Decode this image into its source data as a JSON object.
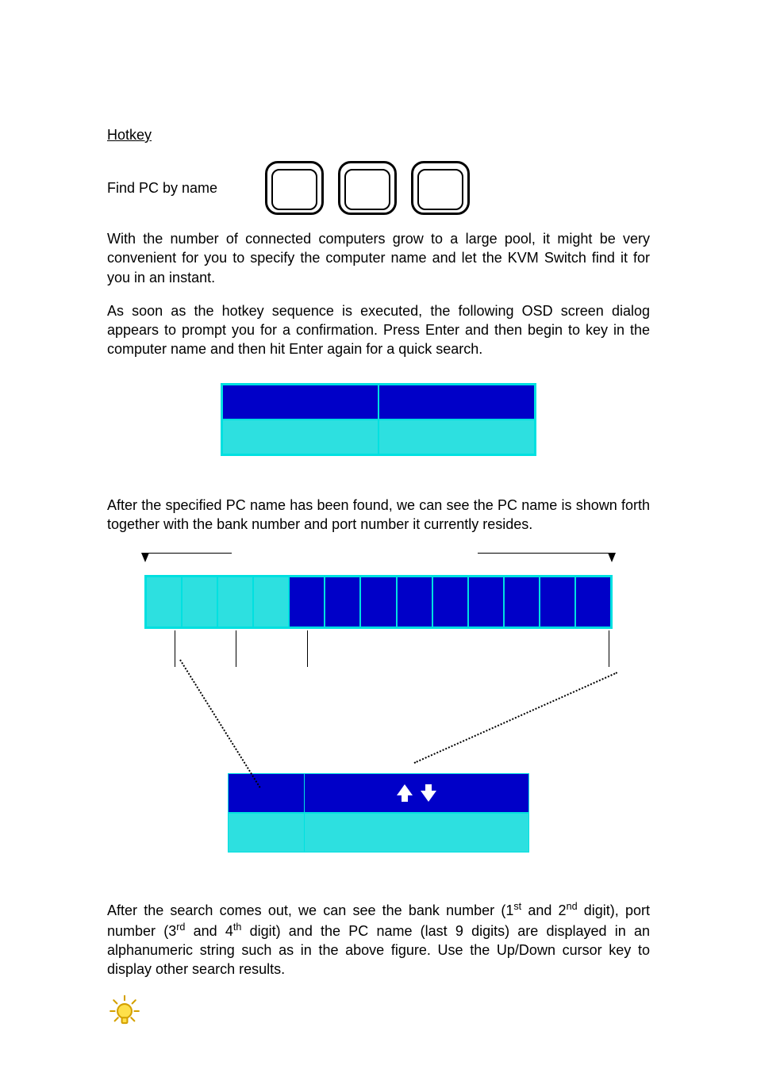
{
  "title": "Hotkey",
  "subtitle": "Find PC by name",
  "para1": "With the number of connected computers grow to a large pool, it might be very convenient for you to specify the computer name and let the KVM Switch find it for you in an instant.",
  "para2": "As soon as the hotkey sequence is executed, the following OSD screen dialog appears to prompt you for a confirmation. Press Enter and then begin to key in the computer name and then hit Enter again for a quick search.",
  "para3": "After the specified PC name has been found, we can see the PC name is shown forth together with the bank number and port number it currently resides.",
  "para4_a": "After the search comes out, we can see the bank number (1",
  "para4_b": "  and 2",
  "para4_c": " digit), port number (3",
  "para4_d": " and 4",
  "para4_e": " digit) and the PC name (last 9 digits) are displayed in an alphanumeric string such as in the above figure. Use the Up/Down cursor key to display other search results.",
  "sup_st": "st",
  "sup_nd": "nd",
  "sup_rd": "rd",
  "sup_th": "th",
  "grid_pattern": [
    "cyan",
    "cyan",
    "cyan",
    "cyan",
    "blue",
    "blue",
    "blue",
    "blue",
    "blue",
    "blue",
    "blue",
    "blue",
    "blue"
  ]
}
